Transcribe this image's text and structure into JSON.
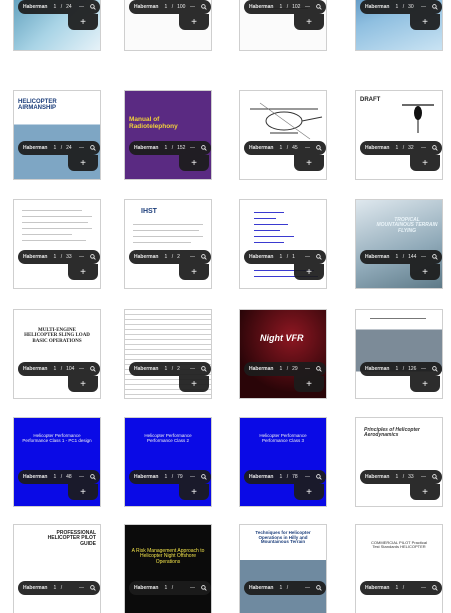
{
  "viewer": {
    "toolbar_label": "Haberman",
    "zoom_out": "—",
    "add_label": "+",
    "search_icon": "magnifier-icon"
  },
  "tiles": [
    {
      "page": "1",
      "total": "24",
      "title": ""
    },
    {
      "page": "1",
      "total": "100",
      "title": ""
    },
    {
      "page": "1",
      "total": "102",
      "title": ""
    },
    {
      "page": "1",
      "total": "30",
      "title": ""
    },
    {
      "page": "1",
      "total": "24",
      "title": "HELICOPTER AIRMANSHIP"
    },
    {
      "page": "1",
      "total": "152",
      "title": "Manual of Radiotelephony"
    },
    {
      "page": "1",
      "total": "45",
      "title": ""
    },
    {
      "page": "1",
      "total": "32",
      "title": "DRAFT"
    },
    {
      "page": "1",
      "total": "33",
      "title": ""
    },
    {
      "page": "1",
      "total": "2",
      "title": "IHST"
    },
    {
      "page": "1",
      "total": "1",
      "title": ""
    },
    {
      "page": "1",
      "total": "144",
      "title": "TROPICAL MOUNTAINOUS TERRAIN FLYING"
    },
    {
      "page": "1",
      "total": "104",
      "title": "MULTI-ENGINE HELICOPTER SLING LOAD BASIC OPERATIONS"
    },
    {
      "page": "1",
      "total": "2",
      "title": ""
    },
    {
      "page": "1",
      "total": "29",
      "title": "Night VFR"
    },
    {
      "page": "1",
      "total": "126",
      "title": ""
    },
    {
      "page": "1",
      "total": "48",
      "title": "Helicopter Performance Performance Class 1 - PC1 design"
    },
    {
      "page": "1",
      "total": "79",
      "title": "Helicopter Performance Performance Class 2"
    },
    {
      "page": "1",
      "total": "78",
      "title": "Helicopter Performance Performance Class 3"
    },
    {
      "page": "1",
      "total": "33",
      "title": "Principles of Helicopter Aerodynamics"
    },
    {
      "page": "1",
      "total": "",
      "title": "PROFESSIONAL HELICOPTER PILOT GUIDE"
    },
    {
      "page": "1",
      "total": "",
      "title": "A Risk Management Approach to Helicopter Night Offshore Operations"
    },
    {
      "page": "1",
      "total": "",
      "title": "Techniques for Helicopter Operations in Hilly and Mountainous Terrain"
    },
    {
      "page": "1",
      "total": "",
      "title": "COMMERCIAL PILOT Practical Test Standards HELICOPTER"
    }
  ]
}
